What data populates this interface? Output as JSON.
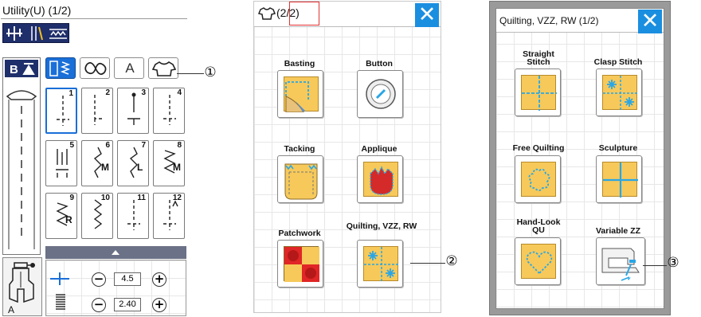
{
  "screen1": {
    "title": "Utility(U) (1/2)",
    "foot_letter": "A",
    "tabs": [
      "utility-stitch-tab",
      "decorative-stitch-tab",
      "letters-tab",
      "shirt-tab"
    ],
    "letters_tab_label": "A",
    "stitches": [
      {
        "num": "1",
        "suffix": ""
      },
      {
        "num": "2",
        "suffix": ""
      },
      {
        "num": "3",
        "suffix": ""
      },
      {
        "num": "4",
        "suffix": ""
      },
      {
        "num": "5",
        "suffix": ""
      },
      {
        "num": "6",
        "suffix": "M"
      },
      {
        "num": "7",
        "suffix": "L"
      },
      {
        "num": "8",
        "suffix": "M"
      },
      {
        "num": "9",
        "suffix": "R"
      },
      {
        "num": "10",
        "suffix": ""
      },
      {
        "num": "11",
        "suffix": ""
      },
      {
        "num": "12",
        "suffix": ""
      }
    ],
    "width_value": "4.5",
    "length_value": "2.40",
    "minus": "−",
    "plus": "+"
  },
  "screen2": {
    "title": "(2/2)",
    "items": [
      "Basting",
      "Button",
      "Tacking",
      "Applique",
      "Patchwork",
      "Quilting, VZZ, RW"
    ]
  },
  "screen3": {
    "title": "Quilting, VZZ, RW (1/2)",
    "items": [
      "Straight Stitch",
      "Clasp Stitch",
      "Free Quilting",
      "Sculpture",
      "Hand-Look QU",
      "Variable ZZ"
    ]
  },
  "close_glyph": "✕",
  "callouts": [
    "①",
    "②",
    "③"
  ],
  "colors": {
    "accent": "#1a8fe0",
    "navy": "#1f2f6b",
    "tile": "#f6c95a",
    "stitch_blue": "#29a6e6",
    "selected": "#1a6fd8"
  }
}
